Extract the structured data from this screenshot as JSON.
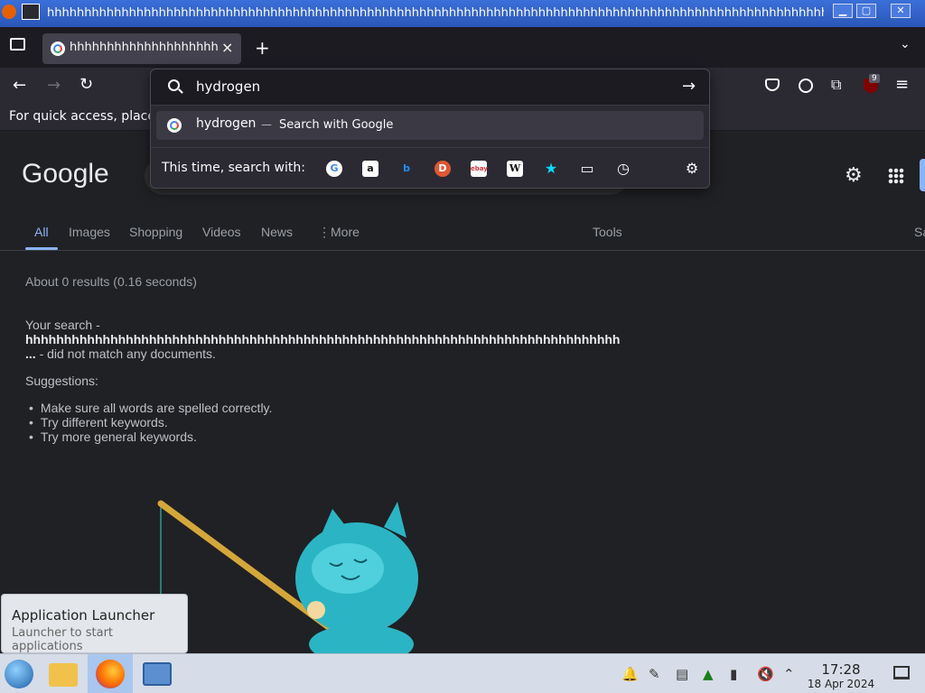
{
  "window": {
    "title": "hhhhhhhhhhhhhhhhhhhhhhhhhhhhhhhhhhhhhhhhhhhhhhhhhhhhhhhhhhhhhhhhhhhhhhhhhhhhhhhhhhhhhhhhhhhhhhhhhhhhhhhhhhhhhhhhhhhhh",
    "buttons": {
      "minimize": "▁",
      "maximize": "▢",
      "close": "✕"
    }
  },
  "browser": {
    "tab_title": "hhhhhhhhhhhhhhhhhhhhhhhhh",
    "tab_close": "×",
    "new_tab": "+",
    "bookmarks_hint": "For quick access, place",
    "extension_badge": "9"
  },
  "urlbar": {
    "query": "hydrogen",
    "suggestion_term": "hydrogen",
    "suggestion_dash": "—",
    "suggestion_hint": "Search with Google",
    "oneoff_label": "This time, search with:",
    "engines": [
      "G",
      "a",
      "b",
      "D",
      "ebay",
      "W",
      "★",
      "▭",
      "◷"
    ]
  },
  "google": {
    "logo": "Google",
    "tabs": [
      "All",
      "Images",
      "Shopping",
      "Videos",
      "News",
      "More"
    ],
    "tools": "Tools",
    "right_cut": "Sa",
    "stats": "About 0 results (0.16 seconds)",
    "no_match_prefix": "Your search -",
    "no_match_query": "hhhhhhhhhhhhhhhhhhhhhhhhhhhhhhhhhhhhhhhhhhhhhhhhhhhhhhhhhhhhhhhhhhhhhhhhhhhhh ...",
    "no_match_suffix": "- did not match any documents.",
    "suggestions_label": "Suggestions:",
    "suggestions": [
      "Make sure all words are spelled correctly.",
      "Try different keywords.",
      "Try more general keywords."
    ]
  },
  "tooltip": {
    "title": "Application Launcher",
    "subtitle": "Launcher to start applications"
  },
  "taskbar": {
    "time": "17:28",
    "date": "18 Apr 2024"
  },
  "colors": {
    "accent": "#8ab4f8",
    "page_bg": "#202124",
    "toolbar_bg": "#2b2a33"
  }
}
